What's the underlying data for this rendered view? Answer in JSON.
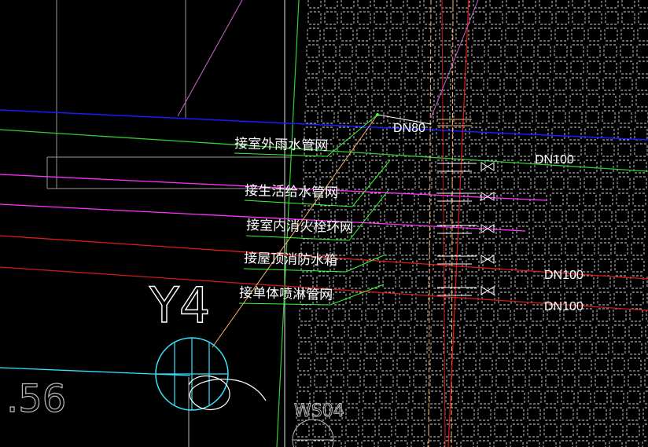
{
  "drawing": {
    "background": "#000000",
    "colors": {
      "blue_line": "#1a1aff",
      "green_line": "#33cc33",
      "bright_green": "#33ff33",
      "magenta": "#ff33ff",
      "red": "#e01a1a",
      "dark_red": "#cc1a1a",
      "white": "#ffffff",
      "cyan": "#33e6ff",
      "tile_grid": "#d9d9d9",
      "orange": "#ffb366",
      "pink_diag": "#cc66cc",
      "faint": "#999999"
    },
    "labels": {
      "rain": "接室外雨水管网",
      "domestic": "接生活给水管网",
      "hydrant": "接室内消火栓环网",
      "roof_tank": "接屋顶消防水箱",
      "sprinkler": "接单体喷淋管网"
    },
    "pipe_sizes": {
      "dn80": "DN80",
      "dn100_top": "DN100",
      "dn100_mid": "DN100",
      "dn100_bottom": "DN100"
    },
    "grid_marks": {
      "axis_label": "Y4",
      "coordinate": ".56",
      "well_tag": "WS04"
    }
  }
}
